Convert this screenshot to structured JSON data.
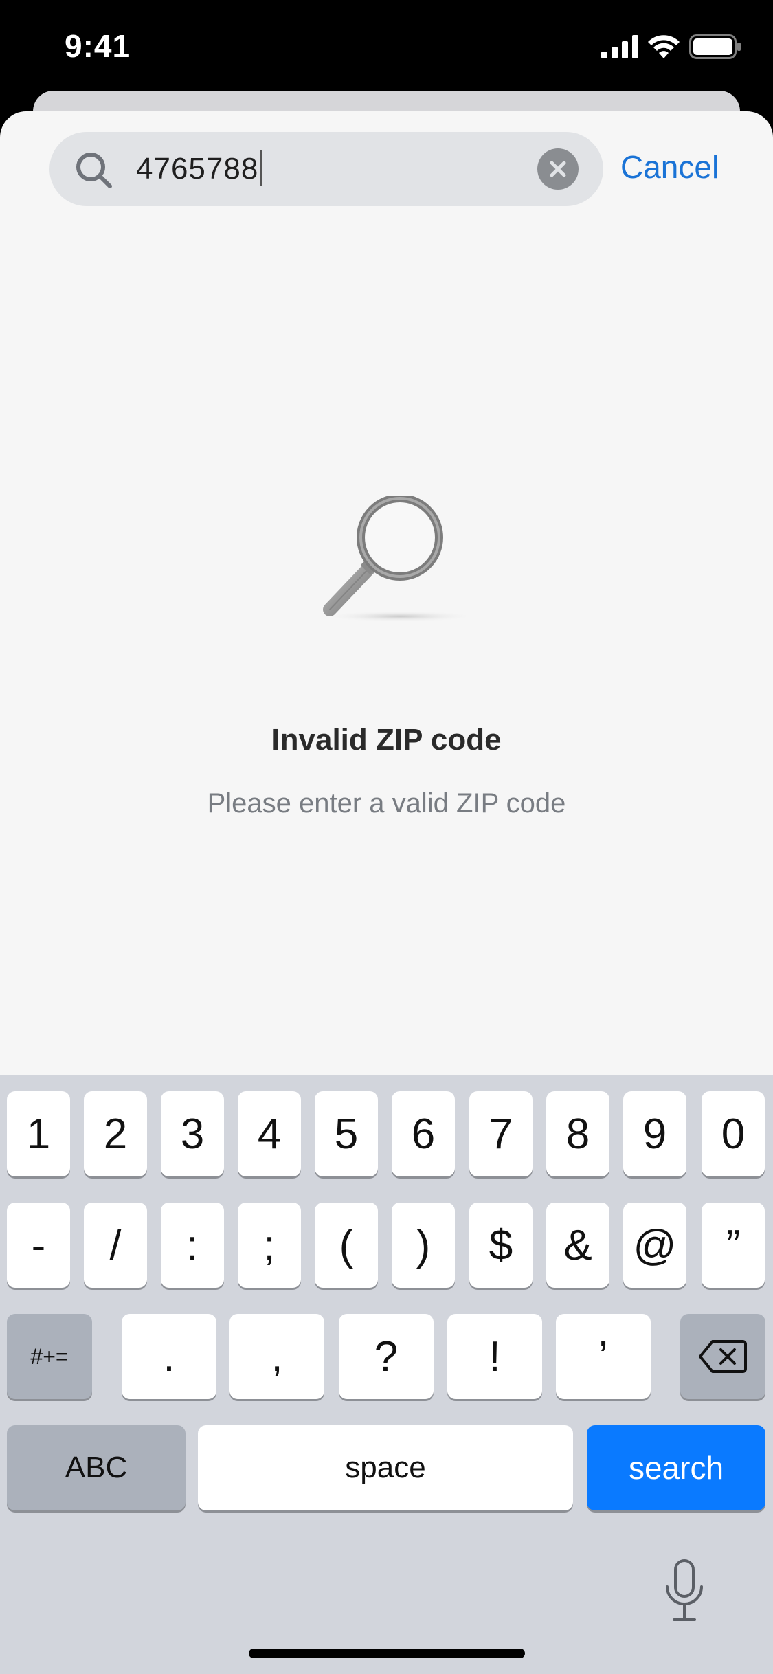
{
  "status_bar": {
    "time": "9:41",
    "icons": [
      "signal-icon",
      "wifi-icon",
      "battery-icon"
    ]
  },
  "search": {
    "value": "4765788",
    "cancel_label": "Cancel",
    "icon": "search-icon",
    "clear_icon": "clear-icon"
  },
  "empty_state": {
    "icon": "magnifying-glass-icon",
    "title": "Invalid ZIP code",
    "subtitle": "Please enter a valid ZIP code"
  },
  "keyboard": {
    "row1": [
      "1",
      "2",
      "3",
      "4",
      "5",
      "6",
      "7",
      "8",
      "9",
      "0"
    ],
    "row2": [
      "-",
      "/",
      ":",
      ";",
      "(",
      ")",
      "$",
      "&",
      "@",
      "”"
    ],
    "symbols_label": "#+=",
    "row3": [
      ".",
      ",",
      "?",
      "!",
      "’"
    ],
    "abc_label": "ABC",
    "space_label": "space",
    "search_label": "search",
    "accent_color": "#0a7aff"
  },
  "colors": {
    "link": "#1a73d6",
    "sheet_bg": "#f6f6f6",
    "keyboard_bg": "#d2d5dc"
  }
}
